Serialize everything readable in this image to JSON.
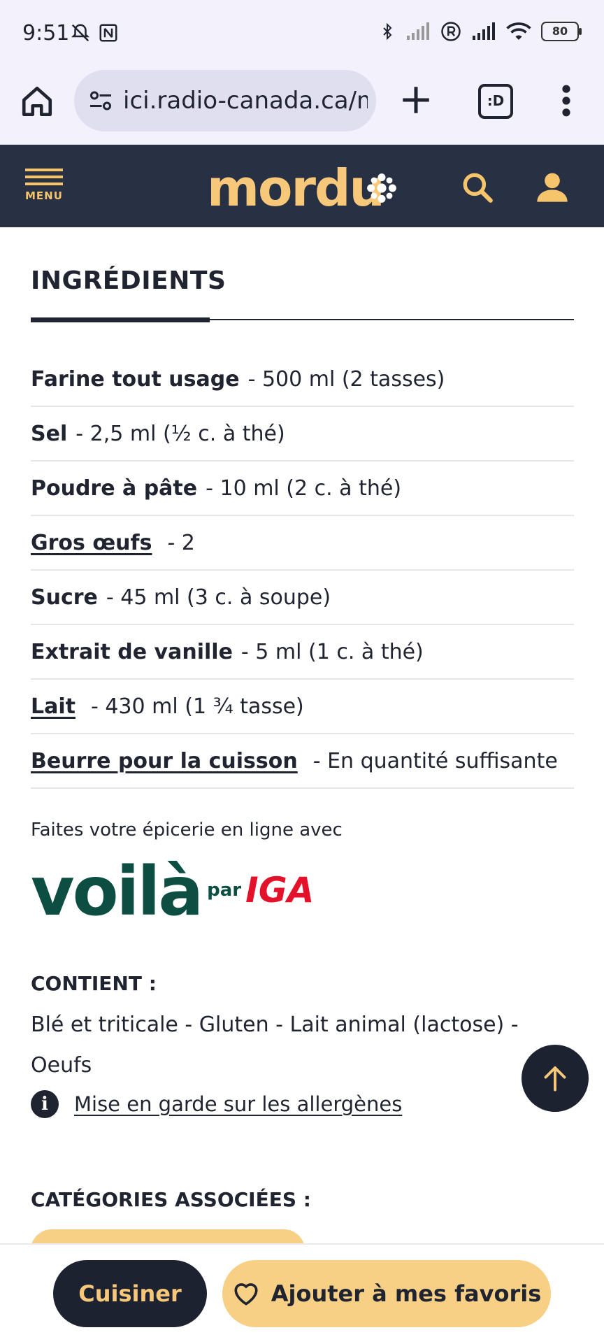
{
  "status_bar": {
    "time": "9:51",
    "battery": "80",
    "icons": [
      "bell-off-icon",
      "nfc-icon",
      "bluetooth-icon",
      "signal-icon",
      "registered-icon",
      "signal-icon",
      "wifi-icon",
      "battery-icon"
    ]
  },
  "browser": {
    "url": "ici.radio-canada.ca/mordu",
    "tabs_count_label": ":D"
  },
  "site_header": {
    "menu_label": "MENU",
    "logo_text": "mordu"
  },
  "ingredients": {
    "title": "INGRÉDIENTS",
    "items": [
      {
        "name": "Farine tout usage",
        "qty": "- 500 ml (2 tasses)",
        "link": false
      },
      {
        "name": "Sel",
        "qty": "- 2,5 ml (½ c. à thé)",
        "link": false
      },
      {
        "name": "Poudre à pâte",
        "qty": "- 10 ml (2 c. à thé)",
        "link": false
      },
      {
        "name": "Gros œufs",
        "qty": "- 2",
        "link": true
      },
      {
        "name": "Sucre",
        "qty": "- 45 ml (3 c. à soupe)",
        "link": false
      },
      {
        "name": "Extrait de vanille",
        "qty": "- 5 ml (1 c. à thé)",
        "link": false
      },
      {
        "name": "Lait",
        "qty": "- 430 ml (1 ¾ tasse)",
        "link": true
      },
      {
        "name": "Beurre pour la cuisson",
        "qty": "- En quantité suffisante",
        "link": true
      }
    ]
  },
  "grocery": {
    "text": "Faites votre épicerie en ligne avec",
    "brand_word": "voilà",
    "brand_par": "par",
    "brand_iga": "IGA"
  },
  "contains": {
    "title": "CONTIENT :",
    "text": "Blé et triticale - Gluten - Lait animal (lactose) - Oeufs",
    "allergen_link": "Mise en garde sur les allergènes"
  },
  "categories": {
    "title": "CATÉGORIES ASSOCIÉES :"
  },
  "actions": {
    "cook_label": "Cuisiner",
    "favorite_label": "Ajouter à mes favoris"
  },
  "colors": {
    "header_bg": "#283044",
    "accent": "#f7c77a",
    "voila_green": "#0d4e43",
    "iga_red": "#e4112a"
  }
}
